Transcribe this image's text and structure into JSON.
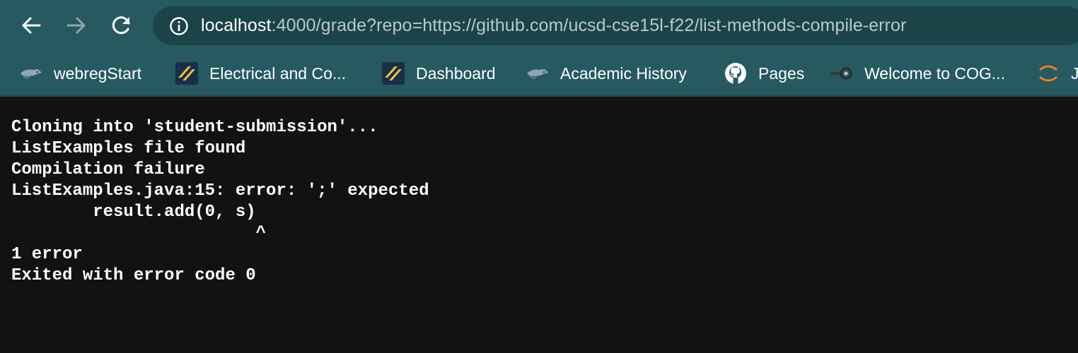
{
  "browser": {
    "url_host": "localhost",
    "url_rest": ":4000/grade?repo=https://github.com/ucsd-cse15l-f22/list-methods-compile-error",
    "nav_icons": [
      "back-icon",
      "forward-icon",
      "reload-icon"
    ],
    "colors": {
      "chrome": "#265a60",
      "omnibox": "#1b4448",
      "page_bg": "#121212"
    }
  },
  "bookmarks": [
    {
      "label": "webregStart",
      "icon": "triton-icon"
    },
    {
      "label": "Electrical and Co...",
      "icon": "stripes-logo-icon"
    },
    {
      "label": "Dashboard",
      "icon": "stripes-logo-icon"
    },
    {
      "label": "Academic History",
      "icon": "triton-icon"
    },
    {
      "label": "Pages",
      "icon": "github-icon"
    },
    {
      "label": "Welcome to COG...",
      "icon": "cogs-icon"
    },
    {
      "label": "J",
      "icon": "jupyter-icon"
    }
  ],
  "output": {
    "lines": [
      "Cloning into 'student-submission'...",
      "ListExamples file found",
      "Compilation failure",
      "ListExamples.java:15: error: ';' expected",
      "        result.add(0, s)",
      "                        ^",
      "1 error",
      "Exited with error code 0"
    ]
  }
}
